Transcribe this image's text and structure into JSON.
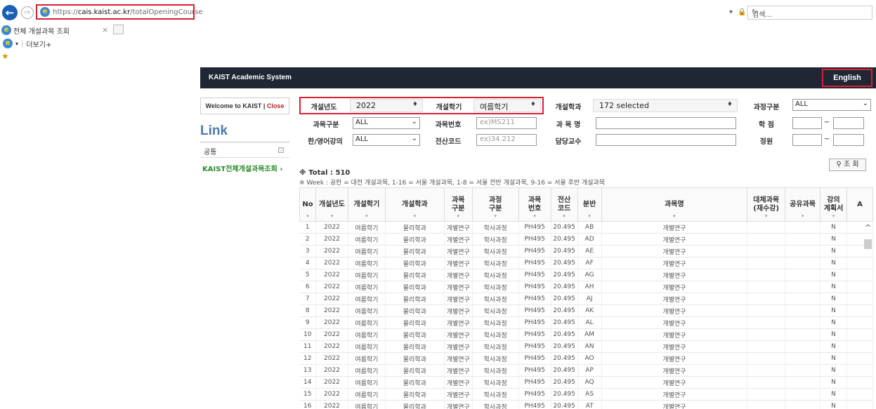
{
  "browser": {
    "url_prefix": "https://",
    "url_host": "cais.kaist.ac.kr",
    "url_path": "/totalOpeningCourse",
    "tab_title": "전체 개설과목 조회",
    "search_placeholder": "검색...",
    "toolbar_more": "더보기+",
    "addr_icons": "▾ 🔒 ↻"
  },
  "app": {
    "title": "KAIST Academic System",
    "language_button": "English",
    "welcome_text": "Welcome to KAIST",
    "welcome_sep": " | ",
    "close_label": "Close",
    "link_heading": "Link",
    "sidebar_common": "공통",
    "sidebar_link": "KAIST전체개설과목조회"
  },
  "filters": {
    "year_label": "개설년도",
    "year_value": "2022",
    "semester_label": "개설학기",
    "semester_value": "여름학기",
    "dept_label": "개설학과",
    "dept_value": "172 selected",
    "course_type_label": "과정구분",
    "course_type_value": "ALL",
    "subject_type_label": "과목구분",
    "subject_type_value": "ALL",
    "subject_no_label": "과목번호",
    "subject_no_placeholder": "ex)MS211",
    "subject_name_label": "과 목 명",
    "credit_label": "학 점",
    "lang_label": "한/영어강의",
    "lang_value": "ALL",
    "code_label": "전산코드",
    "code_placeholder": "ex)34.212",
    "prof_label": "담당교수",
    "capacity_label": "정원",
    "tilde": "~",
    "search_button": "조 회"
  },
  "summary": {
    "total": "※ Total : 510",
    "week_note": "※ Week : 공란 = 대전 개설과목, 1-16 = 서울 개설과목, 1-8 = 서울 전반 개설과목, 9-16 = 서울 후반 개설과목"
  },
  "table": {
    "headers": [
      "No",
      "개설년도",
      "개설학기",
      "개설학과",
      "과목\n구분",
      "과정\n구분",
      "과목\n번호",
      "전산\n코드",
      "분반",
      "과목명",
      "대체과목\n(재수강)",
      "공유과목",
      "강의\n계획서",
      "A"
    ],
    "rows": [
      [
        "1",
        "2022",
        "여름학기",
        "물리학과",
        "개별연구",
        "학사과정",
        "PH495",
        "20.495",
        "AB",
        "개별연구",
        "",
        "",
        "N"
      ],
      [
        "2",
        "2022",
        "여름학기",
        "물리학과",
        "개별연구",
        "학사과정",
        "PH495",
        "20.495",
        "AD",
        "개별연구",
        "",
        "",
        "N"
      ],
      [
        "3",
        "2022",
        "여름학기",
        "물리학과",
        "개별연구",
        "학사과정",
        "PH495",
        "20.495",
        "AE",
        "개별연구",
        "",
        "",
        "N"
      ],
      [
        "4",
        "2022",
        "여름학기",
        "물리학과",
        "개별연구",
        "학사과정",
        "PH495",
        "20.495",
        "AF",
        "개별연구",
        "",
        "",
        "N"
      ],
      [
        "5",
        "2022",
        "여름학기",
        "물리학과",
        "개별연구",
        "학사과정",
        "PH495",
        "20.495",
        "AG",
        "개별연구",
        "",
        "",
        "N"
      ],
      [
        "6",
        "2022",
        "여름학기",
        "물리학과",
        "개별연구",
        "학사과정",
        "PH495",
        "20.495",
        "AH",
        "개별연구",
        "",
        "",
        "N"
      ],
      [
        "7",
        "2022",
        "여름학기",
        "물리학과",
        "개별연구",
        "학사과정",
        "PH495",
        "20.495",
        "AJ",
        "개별연구",
        "",
        "",
        "N"
      ],
      [
        "8",
        "2022",
        "여름학기",
        "물리학과",
        "개별연구",
        "학사과정",
        "PH495",
        "20.495",
        "AK",
        "개별연구",
        "",
        "",
        "N"
      ],
      [
        "9",
        "2022",
        "여름학기",
        "물리학과",
        "개별연구",
        "학사과정",
        "PH495",
        "20.495",
        "AL",
        "개별연구",
        "",
        "",
        "N"
      ],
      [
        "10",
        "2022",
        "여름학기",
        "물리학과",
        "개별연구",
        "학사과정",
        "PH495",
        "20.495",
        "AM",
        "개별연구",
        "",
        "",
        "N"
      ],
      [
        "11",
        "2022",
        "여름학기",
        "물리학과",
        "개별연구",
        "학사과정",
        "PH495",
        "20.495",
        "AN",
        "개별연구",
        "",
        "",
        "N"
      ],
      [
        "12",
        "2022",
        "여름학기",
        "물리학과",
        "개별연구",
        "학사과정",
        "PH495",
        "20.495",
        "AO",
        "개별연구",
        "",
        "",
        "N"
      ],
      [
        "13",
        "2022",
        "여름학기",
        "물리학과",
        "개별연구",
        "학사과정",
        "PH495",
        "20.495",
        "AP",
        "개별연구",
        "",
        "",
        "N"
      ],
      [
        "14",
        "2022",
        "여름학기",
        "물리학과",
        "개별연구",
        "학사과정",
        "PH495",
        "20.495",
        "AQ",
        "개별연구",
        "",
        "",
        "N"
      ],
      [
        "15",
        "2022",
        "여름학기",
        "물리학과",
        "개별연구",
        "학사과정",
        "PH495",
        "20.495",
        "AS",
        "개별연구",
        "",
        "",
        "N"
      ],
      [
        "16",
        "2022",
        "여름학기",
        "물리학과",
        "개별연구",
        "학사과정",
        "PH495",
        "20.495",
        "AT",
        "개별연구",
        "",
        "",
        "N"
      ]
    ]
  },
  "colors": {
    "header_bg": "#1f2735",
    "highlight": "#d9202f",
    "link_heading": "#4a7ab0",
    "sidebar_link": "#2a8a2a"
  }
}
